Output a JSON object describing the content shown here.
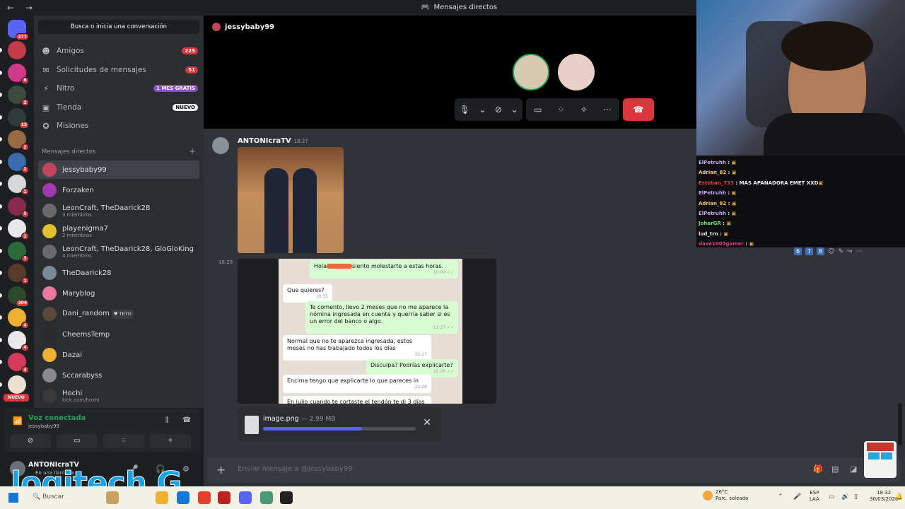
{
  "window": {
    "title": "Mensajes directos",
    "nav_arrows": "← →"
  },
  "servers": {
    "home_badge": "277",
    "items": [
      {
        "badge": "",
        "color": "#c33b4a"
      },
      {
        "badge": "6",
        "color": "#d03a8a"
      },
      {
        "badge": "2",
        "color": "#3a4a3c"
      },
      {
        "badge": "15",
        "color": "#2f3a3a"
      },
      {
        "badge": "2",
        "color": "#9a6a44"
      },
      {
        "badge": "2",
        "color": "#3a6ab0"
      },
      {
        "badge": "1",
        "color": "#d8d8d8"
      },
      {
        "badge": "5",
        "color": "#8a2a4a"
      },
      {
        "badge": "1",
        "color": "#e8e8e8"
      },
      {
        "badge": "3",
        "color": "#2a6a3a"
      },
      {
        "badge": "1",
        "color": "#5a3a2a"
      },
      {
        "badge": "304",
        "color": "#2a4a2a"
      },
      {
        "badge": "4",
        "color": "#f0b030"
      },
      {
        "badge": "4",
        "color": "#e8e8e8"
      },
      {
        "badge": "4",
        "color": "#d63a5a"
      },
      {
        "badge": "",
        "color": "#e8e0d0"
      }
    ],
    "nuevo_label": "NUEVO"
  },
  "sidebar": {
    "search_placeholder": "Busca o inicia una conversación",
    "nav": [
      {
        "icon": "friends-icon",
        "glyph": "☻",
        "label": "Amigos",
        "badge": "225",
        "badge_type": "count"
      },
      {
        "icon": "mail-icon",
        "glyph": "✉",
        "label": "Solicitudes de mensajes",
        "badge": "51",
        "badge_type": "count"
      },
      {
        "icon": "nitro-icon",
        "glyph": "⚡",
        "label": "Nitro",
        "badge": "1 MES GRATIS",
        "badge_type": "nitro"
      },
      {
        "icon": "shop-icon",
        "glyph": "▣",
        "label": "Tienda",
        "badge": "NUEVO",
        "badge_type": "new"
      },
      {
        "icon": "quests-icon",
        "glyph": "✪",
        "label": "Misiones",
        "badge": "",
        "badge_type": ""
      }
    ],
    "dm_header": "Mensajes directos",
    "dm_add": "+",
    "dms": [
      {
        "name": "jessybaby99",
        "sub": "",
        "color": "#c2455c",
        "tag": ""
      },
      {
        "name": "Forzaken",
        "sub": "",
        "color": "#a03ab0",
        "tag": ""
      },
      {
        "name": "LeonCraft, TheDaarick28",
        "sub": "3 miembros",
        "color": "#6a6a6a",
        "tag": ""
      },
      {
        "name": "playenigma7",
        "sub": "2 miembros",
        "color": "#e0c030",
        "tag": ""
      },
      {
        "name": "LeonCraft, TheDaarick28, GloGloKing",
        "sub": "4 miembros",
        "color": "#6a6a6a",
        "tag": ""
      },
      {
        "name": "TheDaarick28",
        "sub": "",
        "color": "#7a8a9a",
        "tag": ""
      },
      {
        "name": "Maryblog",
        "sub": "",
        "color": "#e87aa0",
        "tag": ""
      },
      {
        "name": "Dani_random",
        "sub": "",
        "color": "#5a4a3a",
        "tag": "♥ TETO"
      },
      {
        "name": "CheemsTemp",
        "sub": "",
        "color": "#2a2a2a",
        "tag": ""
      },
      {
        "name": "Dazai",
        "sub": "",
        "color": "#f0b030",
        "tag": ""
      },
      {
        "name": "Sccarabyss",
        "sub": "",
        "color": "#8a8a8a",
        "tag": ""
      },
      {
        "name": "Hochi",
        "sub": "kick.com/hoxhi",
        "color": "#3a3a3a",
        "tag": ""
      }
    ]
  },
  "voice": {
    "status": "Voz conectada",
    "channel": "jessybaby99"
  },
  "user": {
    "name": "ANTONIcraTV",
    "status": "En una llamada"
  },
  "logo_text": "logitech G",
  "call": {
    "title": "jessybaby99"
  },
  "stream_chat": [
    {
      "user": "ElPetruhh",
      "color": "#c9a4f5",
      "text": ""
    },
    {
      "user": "Adrian_82",
      "color": "#f2c56b",
      "text": ""
    },
    {
      "user": "Esteban_733",
      "color": "#e04040",
      "text": "MÁS APAÑADORA EMET XXD"
    },
    {
      "user": "ElPetruhh",
      "color": "#c9a4f5",
      "text": ""
    },
    {
      "user": "Adrian_82",
      "color": "#f2c56b",
      "text": ""
    },
    {
      "user": "ElPetruhh",
      "color": "#c9a4f5",
      "text": ""
    },
    {
      "user": "JoharGR",
      "color": "#6be06b",
      "text": ""
    },
    {
      "user": "lud_trn",
      "color": "#efeff1",
      "text": ""
    },
    {
      "user": "dave1003gamer",
      "color": "#e04080",
      "text": ""
    }
  ],
  "msg_tools": {
    "keys": [
      "6",
      "7",
      "8"
    ]
  },
  "messages": {
    "author": "ANTONIcraTV",
    "time": "18:27",
    "time2": "18:28",
    "screenshot_chat": [
      {
        "side": "out",
        "pre": "Hola",
        "text": "siento molestarte a estas horas.",
        "time": "10:00 ✓✓"
      },
      {
        "side": "in",
        "pre": "",
        "text": "Que quieres?",
        "time": "10:55"
      },
      {
        "side": "out",
        "pre": "",
        "text": "Te comento, llevo 2 meses que no me aparece la nómina ingresada en cuenta y querría saber si es un error del banco o algo.",
        "time": "11:27 ✓✓"
      },
      {
        "side": "in",
        "pre": "",
        "text": "Normal que no te aparezca ingresada, estos meses no has trabajado todos los días",
        "time": "22:27"
      },
      {
        "side": "out",
        "pre": "",
        "text": "Disculpa? Podrías explicarte?",
        "time": "22:28 ✓✓"
      },
      {
        "side": "in",
        "pre": "",
        "text": "Encima tengo que explicarte lo que pareces in",
        "time": "22:28"
      },
      {
        "side": "in",
        "pre": "",
        "text": "En julio cuando te cortaste el tendón te di 3 días",
        "time": ""
      }
    ]
  },
  "upload": {
    "filename": "image.png",
    "size": "— 2.99 MB",
    "progress": 0.65
  },
  "composer": {
    "placeholder": "Enviar mensaje a @jessybaby99"
  },
  "taskbar": {
    "search": "Buscar",
    "temp": "26°C",
    "weather": "Parc. soleado",
    "lang1": "ESP",
    "lang2": "LAA",
    "time": "18:32",
    "date": "30/03/2026"
  }
}
